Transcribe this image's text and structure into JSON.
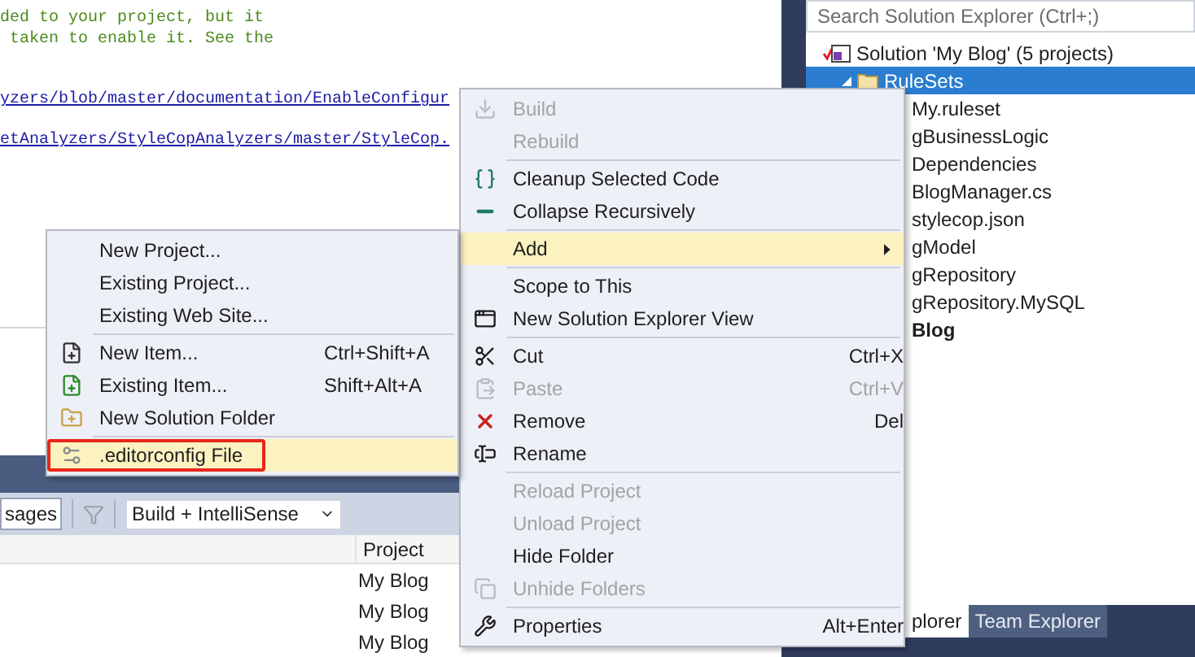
{
  "editor": {
    "lines": [
      {
        "kind": "comment",
        "text": "ded to your project, but it"
      },
      {
        "kind": "comment",
        "text": " taken to enable it. See the"
      },
      {
        "kind": "blank"
      },
      {
        "kind": "blank"
      },
      {
        "kind": "link",
        "text": "yzers/blob/master/documentation/EnableConfigur"
      },
      {
        "kind": "blank"
      },
      {
        "kind": "link",
        "text": "etAnalyzers/StyleCopAnalyzers/master/StyleCop."
      }
    ]
  },
  "context_menu": {
    "groups": [
      [
        {
          "label": "Build",
          "kind": "build",
          "disabled": true,
          "selected": false,
          "has_submenu": false
        },
        {
          "label": "Rebuild",
          "kind": "plain",
          "disabled": true,
          "selected": false,
          "has_submenu": false
        }
      ],
      [
        {
          "label": "Cleanup Selected Code",
          "kind": "braces",
          "disabled": false,
          "selected": false,
          "has_submenu": false
        },
        {
          "label": "Collapse Recursively",
          "kind": "collapse",
          "disabled": false,
          "selected": false,
          "has_submenu": false
        }
      ],
      [
        {
          "label": "Add",
          "kind": "plain",
          "disabled": false,
          "selected": true,
          "has_submenu": true
        }
      ],
      [
        {
          "label": "Scope to This",
          "kind": "plain",
          "disabled": false,
          "selected": false,
          "has_submenu": false
        },
        {
          "label": "New Solution Explorer View",
          "kind": "windows",
          "disabled": false,
          "selected": false,
          "has_submenu": false
        }
      ],
      [
        {
          "label": "Cut",
          "shortcut": "Ctrl+X",
          "kind": "cut",
          "disabled": false,
          "selected": false,
          "has_submenu": false
        },
        {
          "label": "Paste",
          "shortcut": "Ctrl+V",
          "kind": "paste",
          "disabled": true,
          "selected": false,
          "has_submenu": false
        },
        {
          "label": "Remove",
          "shortcut": "Del",
          "kind": "remove",
          "disabled": false,
          "selected": false,
          "has_submenu": false
        },
        {
          "label": "Rename",
          "kind": "rename",
          "disabled": false,
          "selected": false,
          "has_submenu": false
        }
      ],
      [
        {
          "label": "Reload Project",
          "kind": "plain",
          "disabled": true,
          "selected": false,
          "has_submenu": false
        },
        {
          "label": "Unload Project",
          "kind": "plain",
          "disabled": true,
          "selected": false,
          "has_submenu": false
        },
        {
          "label": "Hide Folder",
          "kind": "plain",
          "disabled": false,
          "selected": false,
          "has_submenu": false
        },
        {
          "label": "Unhide Folders",
          "kind": "unhide",
          "disabled": true,
          "selected": false,
          "has_submenu": false
        }
      ],
      [
        {
          "label": "Properties",
          "shortcut": "Alt+Enter",
          "kind": "wrench",
          "disabled": false,
          "selected": false,
          "has_submenu": false
        }
      ]
    ]
  },
  "add_submenu": {
    "groups": [
      [
        {
          "label": "New Project...",
          "kind": "plain",
          "selected": false,
          "boxed": false
        },
        {
          "label": "Existing Project...",
          "kind": "plain",
          "selected": false,
          "boxed": false
        },
        {
          "label": "Existing Web Site...",
          "kind": "plain",
          "selected": false,
          "boxed": false
        }
      ],
      [
        {
          "label": "New Item...",
          "shortcut": "Ctrl+Shift+A",
          "kind": "new-item",
          "selected": false,
          "boxed": false
        },
        {
          "label": "Existing Item...",
          "shortcut": "Shift+Alt+A",
          "kind": "existing-item",
          "selected": false,
          "boxed": false
        },
        {
          "label": "New Solution Folder",
          "kind": "folder",
          "selected": false,
          "boxed": false
        }
      ],
      [
        {
          "label": ".editorconfig File",
          "kind": "editorconfig",
          "selected": true,
          "boxed": true
        }
      ]
    ]
  },
  "output_panel": {
    "toolbar": {
      "messages_button": "sages",
      "dropdown": "Build + IntelliSense"
    },
    "table": {
      "columns": [
        "Project"
      ],
      "rows": [
        [
          "My Blog"
        ],
        [
          "My Blog"
        ],
        [
          "My Blog"
        ]
      ]
    }
  },
  "solution_explorer": {
    "search": {
      "placeholder": "Search Solution Explorer (Ctrl+;)"
    },
    "tree": [
      {
        "label": "Solution 'My Blog' (5 projects)",
        "selected": false,
        "bold": false,
        "children": [
          {
            "label": "RuleSets",
            "selected": true,
            "bold": false,
            "children": [
              {
                "label": "My.ruleset",
                "selected": false,
                "bold": false
              }
            ]
          },
          {
            "label": "gBusinessLogic",
            "selected": false,
            "bold": false,
            "children": [
              {
                "label": "Dependencies",
                "selected": false,
                "bold": false
              },
              {
                "label": "BlogManager.cs",
                "selected": false,
                "bold": false
              },
              {
                "label": "stylecop.json",
                "selected": false,
                "bold": false
              }
            ]
          },
          {
            "label": "gModel",
            "selected": false,
            "bold": false
          },
          {
            "label": "gRepository",
            "selected": false,
            "bold": false
          },
          {
            "label": "gRepository.MySQL",
            "selected": false,
            "bold": false
          },
          {
            "label": "Blog",
            "selected": false,
            "bold": true
          }
        ]
      }
    ],
    "tabs": [
      {
        "label": "plorer",
        "selected": true
      },
      {
        "label": "Team Explorer",
        "selected": false
      }
    ]
  }
}
